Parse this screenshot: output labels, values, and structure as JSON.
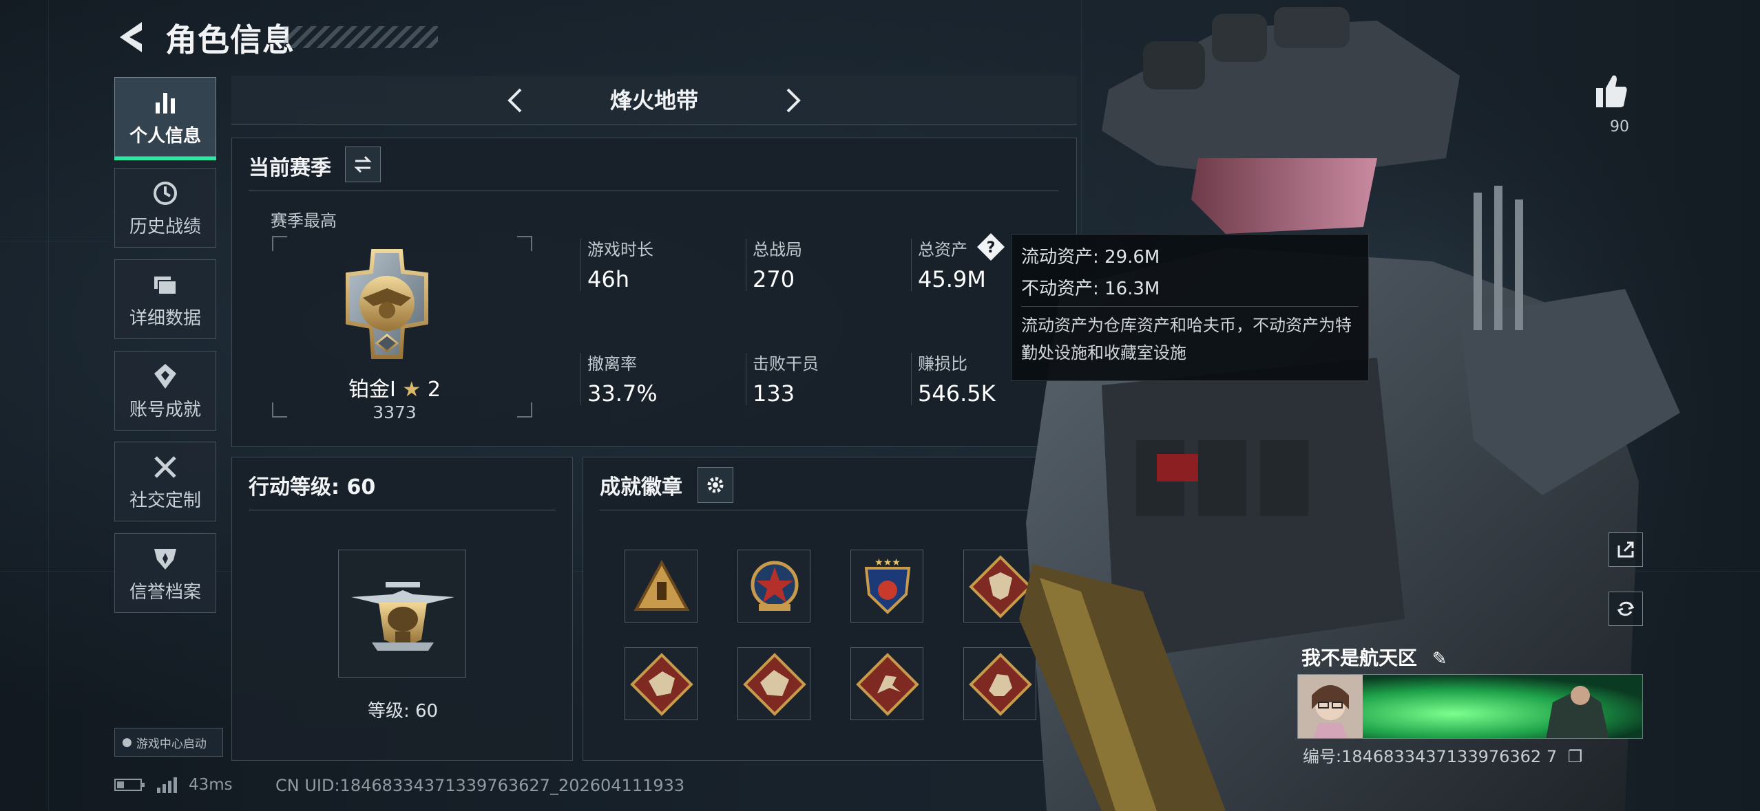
{
  "header": {
    "title": "角色信息"
  },
  "nav": {
    "items": [
      {
        "label": "个人信息",
        "icon": "bar-chart-icon",
        "active": true
      },
      {
        "label": "历史战绩",
        "icon": "history-clock-icon",
        "active": false
      },
      {
        "label": "详细数据",
        "icon": "folders-icon",
        "active": false
      },
      {
        "label": "账号成就",
        "icon": "achievement-icon",
        "active": false
      },
      {
        "label": "社交定制",
        "icon": "tools-icon",
        "active": false
      },
      {
        "label": "信誉档案",
        "icon": "shield-badge-icon",
        "active": false
      }
    ],
    "launch_badge": "游戏中心启动"
  },
  "mode": {
    "title": "烽火地带"
  },
  "season": {
    "title": "当前赛季",
    "best_label": "赛季最高",
    "rank_name": "铂金I",
    "rank_stars": "2",
    "rank_points": "3373",
    "stats": [
      {
        "label": "游戏时长",
        "value": "46h"
      },
      {
        "label": "总战局",
        "value": "270"
      },
      {
        "label": "总资产",
        "value": "45.9M"
      },
      {
        "label": "撤离率",
        "value": "33.7%"
      },
      {
        "label": "击败干员",
        "value": "133"
      },
      {
        "label": "赚损比",
        "value": "546.5K"
      }
    ]
  },
  "tooltip": {
    "liquid": "流动资产: 29.6M",
    "fixed": "不动资产: 16.3M",
    "description": "流动资产为仓库资产和哈夫币，不动资产为特勤处设施和收藏室设施"
  },
  "action_level": {
    "title": "行动等级: 60",
    "level_label": "等级: 60"
  },
  "achievements": {
    "title": "成就徽章",
    "badges": [
      "pyramid-badge",
      "star-medal-badge",
      "shield-stars-badge",
      "wolf-diamond-badge",
      "dragon-diamond-badge",
      "dragon-diamond-badge-2",
      "runner-diamond-badge",
      "crouch-diamond-badge"
    ]
  },
  "profile": {
    "name": "我不是航天区",
    "id_text": "编号:1846833437133976362 7",
    "likes": "90"
  },
  "status": {
    "ping": "43ms",
    "uid": "CN UID:18468334371339763627_202604111933"
  },
  "colors": {
    "accent": "#2fe6a5",
    "gold": "#c8a464",
    "badge_red": "#8b2b24"
  }
}
